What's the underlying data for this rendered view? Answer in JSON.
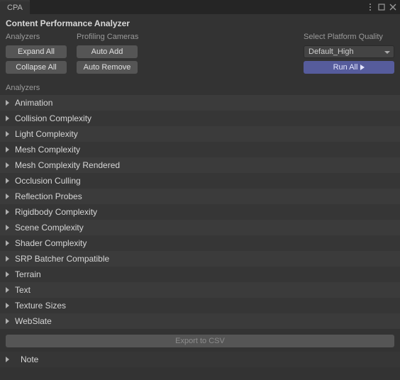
{
  "tab": {
    "title": "CPA"
  },
  "header": {
    "title": "Content Performance Analyzer"
  },
  "toolbar": {
    "analyzers_label": "Analyzers",
    "cameras_label": "Profiling Cameras",
    "expand_all": "Expand All",
    "collapse_all": "Collapse All",
    "auto_add": "Auto Add",
    "auto_remove": "Auto Remove",
    "quality_label": "Select Platform Quality",
    "quality_value": "Default_High",
    "run_all": "Run All"
  },
  "section": {
    "analyzers_label": "Analyzers"
  },
  "analyzers": [
    {
      "label": "Animation"
    },
    {
      "label": "Collision Complexity"
    },
    {
      "label": "Light Complexity"
    },
    {
      "label": "Mesh Complexity"
    },
    {
      "label": "Mesh Complexity Rendered"
    },
    {
      "label": "Occlusion Culling"
    },
    {
      "label": "Reflection Probes"
    },
    {
      "label": "Rigidbody Complexity"
    },
    {
      "label": "Scene Complexity"
    },
    {
      "label": "Shader Complexity"
    },
    {
      "label": "SRP Batcher Compatible"
    },
    {
      "label": "Terrain"
    },
    {
      "label": "Text"
    },
    {
      "label": "Texture Sizes"
    },
    {
      "label": "WebSlate"
    }
  ],
  "bottom": {
    "export_label": "Export to CSV",
    "note_label": "Note"
  }
}
